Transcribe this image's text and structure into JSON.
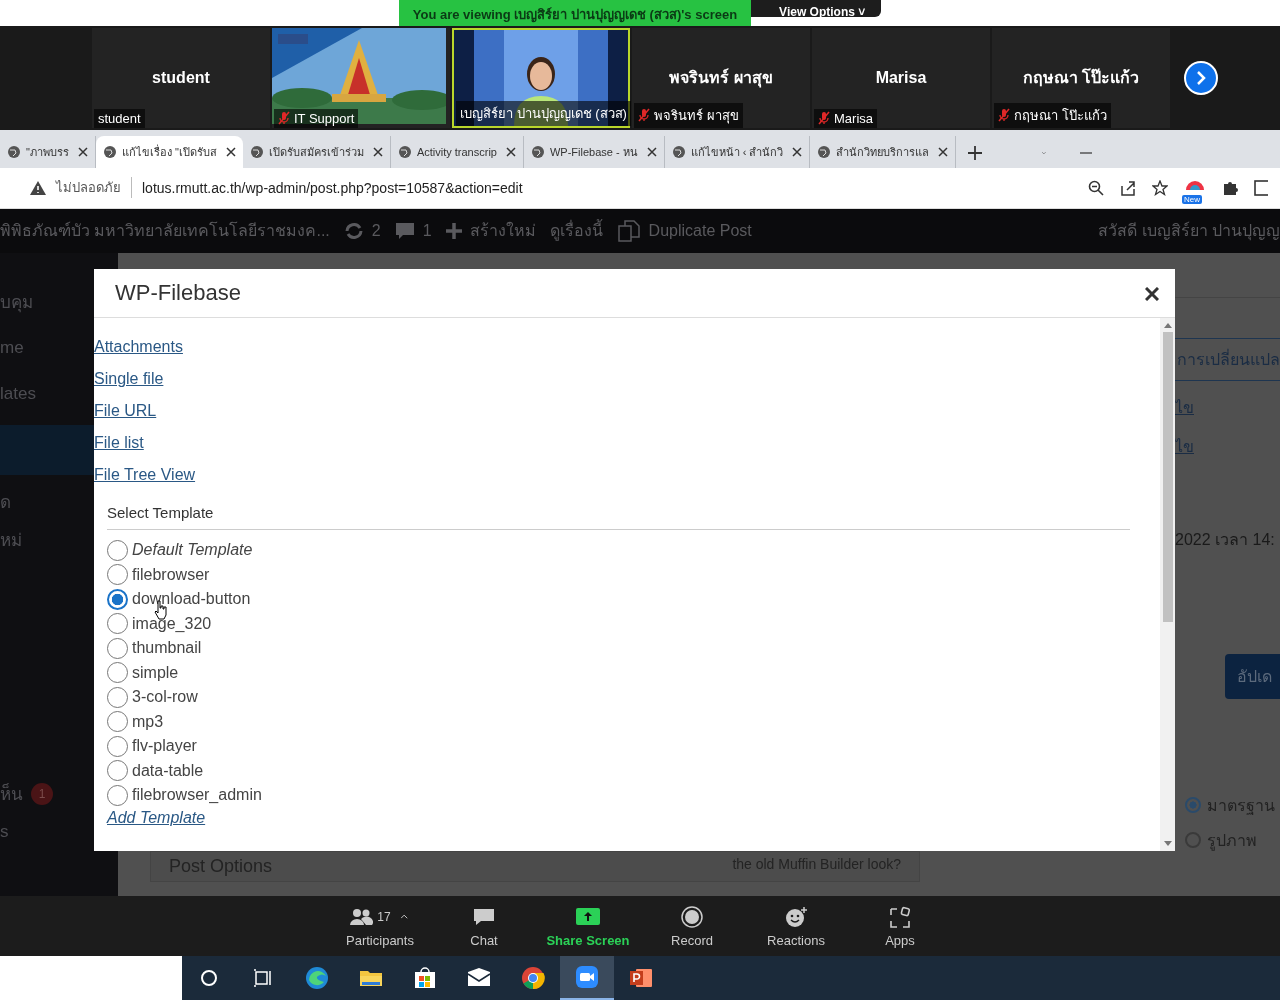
{
  "share_banner": {
    "text": "You are viewing เบญสิร์ยา ปานปุญญเดช (สวส)'s screen",
    "view_options": "View Options",
    "view_options_caret": "˅"
  },
  "participants": [
    {
      "kind": "name",
      "name": "student",
      "label": "student",
      "muted": false,
      "speaking": false
    },
    {
      "kind": "picture",
      "label": "IT Support",
      "muted": true,
      "speaking": false
    },
    {
      "kind": "video",
      "label": "เบญสิร์ยา ปานปุญญเดช (สวส)",
      "muted": false,
      "speaking": true
    },
    {
      "kind": "name",
      "name": "พจรินทร์ ผาสุข",
      "label": "พจรินทร์ ผาสุข",
      "muted": true,
      "speaking": false
    },
    {
      "kind": "name",
      "name": "Marisa",
      "label": "Marisa",
      "muted": true,
      "speaking": false
    },
    {
      "kind": "name",
      "name": "กฤษณา โป๊ะแก้ว",
      "label": "กฤษณา โป๊ะแก้ว",
      "muted": true,
      "speaking": false
    }
  ],
  "browser": {
    "tabs": [
      {
        "title": "\"ภาพบรร",
        "selected": false
      },
      {
        "title": "แก้ไขเรื่อง \"เปิดรับส",
        "selected": true
      },
      {
        "title": "เปิดรับสมัครเข้าร่วม",
        "selected": false
      },
      {
        "title": "Activity transcrip",
        "selected": false
      },
      {
        "title": "WP-Filebase - หน",
        "selected": false
      },
      {
        "title": "แก้ไขหน้า ‹ สำนักวิ",
        "selected": false
      },
      {
        "title": "สำนักวิทยบริการแล",
        "selected": false
      }
    ],
    "security": "ไม่ปลอดภัย",
    "url": "lotus.rmutt.ac.th/wp-admin/post.php?post=10587&action=edit",
    "extension_badge": "New"
  },
  "admin_bar": {
    "site": "พิพิธภัณฑ์บัว มหาวิทยาลัยเทคโนโลยีราชมงค...",
    "updates": "2",
    "comments": "1",
    "new": "สร้างใหม่",
    "view": "ดูเรื่องนี้",
    "duplicate": "Duplicate Post",
    "greeting": "สวัสดี เบญสิร์ยา ปานปุญญ"
  },
  "sidebar": {
    "items": [
      {
        "label": "บคุม",
        "selected": false
      },
      {
        "label": "me",
        "selected": false
      },
      {
        "label": "lates",
        "selected": false
      },
      {
        "selected": true
      },
      {
        "label": "ด",
        "selected": false
      },
      {
        "label": "หม่",
        "selected": false
      },
      {
        "label": "ห็น",
        "badge": "1",
        "selected": false
      },
      {
        "label": "s",
        "selected": false
      }
    ]
  },
  "editor": {
    "change_link": "การเปลี่ยนแปล",
    "edit_links": [
      "ไข",
      "ไข"
    ],
    "date": "2022 เวลา 14:",
    "update_button": "อัปเด",
    "post_options": "Post Options",
    "builder_prompt": "the old Muffin Builder look?",
    "formats": [
      {
        "label": "มาตรฐาน",
        "selected": true
      },
      {
        "label": "รูปภาพ",
        "selected": false
      }
    ]
  },
  "dialog": {
    "title": "WP-Filebase",
    "links": [
      "Attachments",
      "Single file",
      "File URL",
      "File list",
      "File Tree View"
    ],
    "select_template": "Select Template",
    "templates": [
      {
        "label": "Default Template",
        "kind": "default",
        "selected": false
      },
      {
        "label": "filebrowser",
        "kind": "template",
        "selected": false
      },
      {
        "label": "download-button",
        "kind": "template",
        "selected": true
      },
      {
        "label": "image_320",
        "kind": "template",
        "selected": false
      },
      {
        "label": "thumbnail",
        "kind": "template",
        "selected": false
      },
      {
        "label": "simple",
        "kind": "template",
        "selected": false
      },
      {
        "label": "3-col-row",
        "kind": "template",
        "selected": false
      },
      {
        "label": "mp3",
        "kind": "template",
        "selected": false
      },
      {
        "label": "flv-player",
        "kind": "template",
        "selected": false
      },
      {
        "label": "data-table",
        "kind": "template",
        "selected": false
      },
      {
        "label": "filebrowser_admin",
        "kind": "template",
        "selected": false
      }
    ],
    "add_template": "Add Template"
  },
  "zoom_toolbar": {
    "participant_count": "17",
    "items": [
      {
        "kind": "participants",
        "label": "Participants"
      },
      {
        "kind": "chat",
        "label": "Chat"
      },
      {
        "kind": "share",
        "label": "Share Screen"
      },
      {
        "kind": "record",
        "label": "Record"
      },
      {
        "kind": "reactions",
        "label": "Reactions"
      },
      {
        "kind": "apps",
        "label": "Apps"
      }
    ]
  },
  "taskbar": {
    "apps": [
      {
        "kind": "search",
        "selected": false
      },
      {
        "kind": "taskview",
        "selected": false
      },
      {
        "kind": "edge",
        "selected": false
      },
      {
        "kind": "explorer",
        "selected": false
      },
      {
        "kind": "store",
        "selected": false
      },
      {
        "kind": "mail",
        "selected": false
      },
      {
        "kind": "chrome",
        "selected": false
      },
      {
        "kind": "zoom",
        "selected": true
      },
      {
        "kind": "powerpoint",
        "selected": false
      }
    ]
  }
}
